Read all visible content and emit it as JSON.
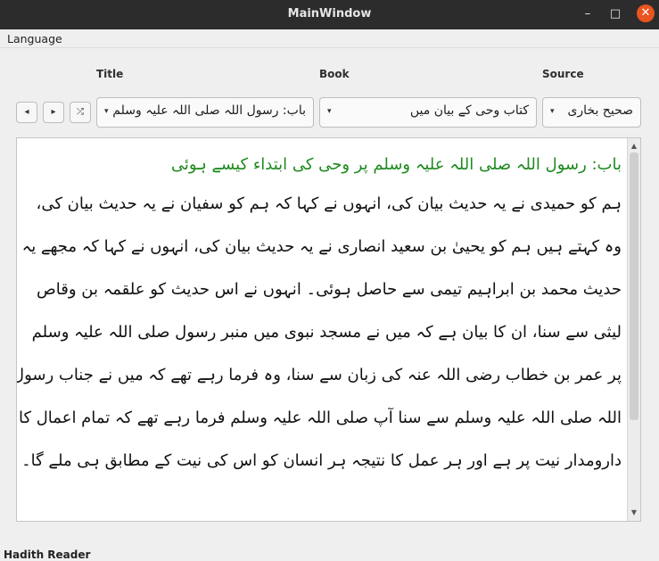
{
  "window": {
    "title": "MainWindow",
    "minimize": "–",
    "maximize": "□",
    "close": "✕"
  },
  "menubar": {
    "language": "Language"
  },
  "labels": {
    "title": "Title",
    "book": "Book",
    "source": "Source"
  },
  "nav": {
    "prev": "◂",
    "next": "▸",
    "shuffle": "⤮"
  },
  "combos": {
    "title_value": "باب: رسول اللہ صلی اللہ علیہ وسلم پرو",
    "book_value": "کتاب وحی کے بیان میں",
    "source_value": "صحیح بخاری",
    "arrow": "▾"
  },
  "content": {
    "heading": "باب: رسول اللہ صلی اللہ علیہ وسلم پر وحی کی ابتداء کیسے ہوئی",
    "lines": [
      "ہم کو حمیدی نے یہ حدیث بیان کی، انہوں نے کہا کہ ہم کو سفیان نے یہ حدیث بیان کی،",
      "وہ کہتے ہیں ہم کو یحییٰ بن سعید انصاری نے یہ حدیث بیان کی، انہوں نے کہا کہ مجھے یہ",
      "حدیث محمد بن ابراہیم تیمی سے حاصل ہوئی۔ انہوں نے اس حدیث کو علقمہ بن وقاص",
      "لیثی سے سنا، ان کا بیان ہے کہ میں نے مسجد نبوی میں منبر رسول صلی اللہ علیہ وسلم",
      "پر عمر بن خطاب رضی اللہ عنہ کی زبان سے سنا، وہ فرما رہے تھے کہ میں نے جناب رسول",
      "اللہ صلی اللہ علیہ وسلم سے سنا آپ صلی اللہ علیہ وسلم فرما رہے تھے کہ تمام اعمال کا",
      "دارومدار نیت پر ہے اور ہر عمل کا نتیجہ ہر انسان کو اس کی نیت کے مطابق ہی ملے گا۔"
    ]
  },
  "scroll": {
    "up": "▲",
    "down": "▼"
  },
  "status": {
    "text": "Hadith Reader"
  }
}
